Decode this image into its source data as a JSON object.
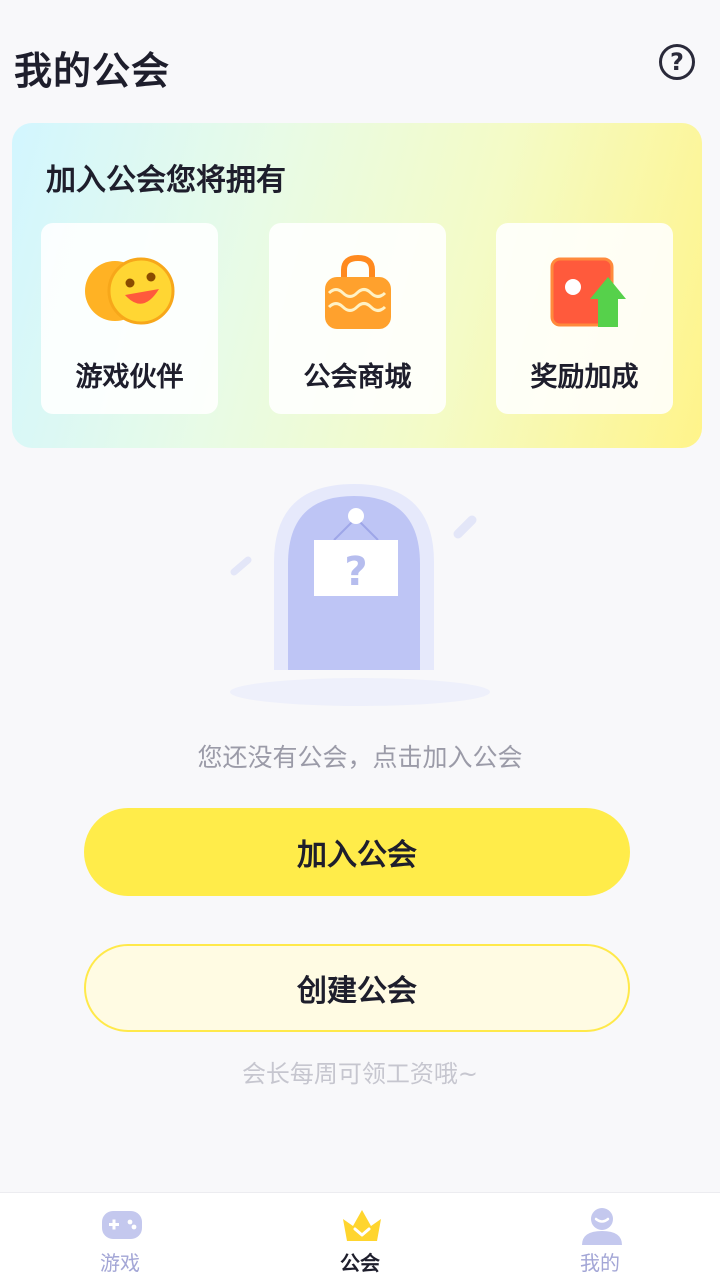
{
  "header": {
    "title": "我的公会",
    "help_icon": "question-circle-icon",
    "help_glyph": "?"
  },
  "benefits": {
    "title": "加入公会您将拥有",
    "items": [
      {
        "label": "游戏伙伴",
        "icon": "smiley-faces-icon"
      },
      {
        "label": "公会商城",
        "icon": "shopping-bag-icon"
      },
      {
        "label": "奖励加成",
        "icon": "reward-boost-icon"
      }
    ]
  },
  "empty_state": {
    "message": "您还没有公会，点击加入公会",
    "illustration": "question-door-icon"
  },
  "actions": {
    "join_label": "加入公会",
    "create_label": "创建公会",
    "hint": "会长每周可领工资哦~"
  },
  "tabbar": {
    "active": "公会",
    "tabs": [
      {
        "label": "游戏",
        "icon": "gamepad-icon"
      },
      {
        "label": "公会",
        "icon": "crown-icon"
      },
      {
        "label": "我的",
        "icon": "user-icon"
      }
    ]
  },
  "colors": {
    "accent": "#ffec4a",
    "tab_inactive": "#a3a6d6",
    "text_muted": "#9b9ba8"
  }
}
